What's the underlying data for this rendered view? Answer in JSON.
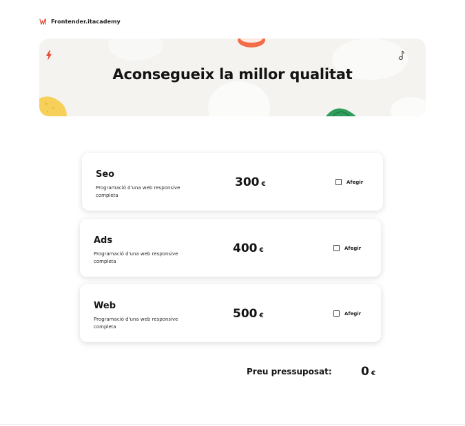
{
  "header": {
    "brand_name": "Frontender.itacademy",
    "logo_icon": "itacademy-logo-icon",
    "accent_color": "#e8462e"
  },
  "hero": {
    "title": "Aconsegueix la millor qualitat",
    "background_color": "#f4f3f0",
    "decorations": [
      "lightning-icon",
      "sushi-icon",
      "music-note-icon",
      "yellow-blob",
      "green-leaf"
    ]
  },
  "services": [
    {
      "name": "Seo",
      "description": "Programació d'una web responsive completa",
      "price": "300",
      "currency": "€",
      "add_label": "Afegir",
      "checked": false
    },
    {
      "name": "Ads",
      "description": "Programació d'una web responsive completa",
      "price": "400",
      "currency": "€",
      "add_label": "Afegir",
      "checked": false
    },
    {
      "name": "Web",
      "description": "Programació d'una web responsive completa",
      "price": "500",
      "currency": "€",
      "add_label": "Afegir",
      "checked": false
    }
  ],
  "total": {
    "label": "Preu pressuposat:",
    "value": "0",
    "currency": "€"
  }
}
